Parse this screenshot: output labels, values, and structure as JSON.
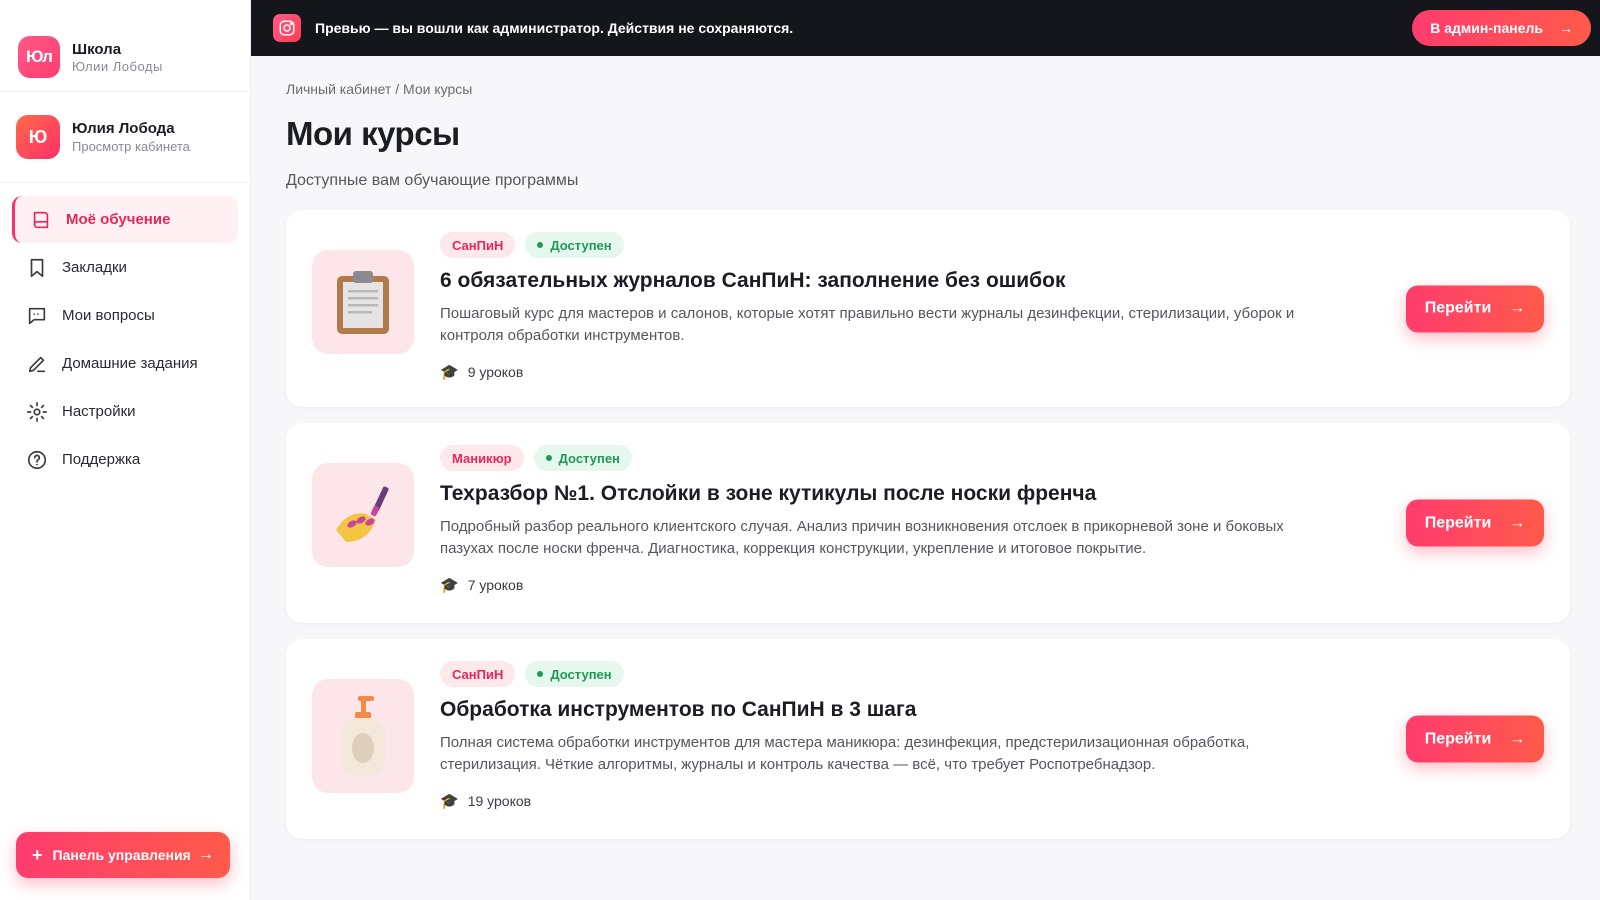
{
  "brand": {
    "logo": "Юл",
    "line1": "Школа",
    "line2": "Юлии Лободы"
  },
  "user": {
    "initial": "Ю",
    "name": "Юлия Лобода",
    "role": "Просмотр кабинета"
  },
  "nav": [
    {
      "label": "Моё обучение",
      "icon": "book-icon",
      "active": true
    },
    {
      "label": "Закладки",
      "icon": "bookmark-icon"
    },
    {
      "label": "Мои вопросы",
      "icon": "chat-icon"
    },
    {
      "label": "Домашние задания",
      "icon": "pencil-icon"
    },
    {
      "label": "Настройки",
      "icon": "gear-icon"
    },
    {
      "label": "Поддержка",
      "icon": "help-icon"
    }
  ],
  "panel_button": {
    "label": "Панель управления"
  },
  "topbar": {
    "message": "Превью — вы вошли как администратор. Действия не сохраняются.",
    "admin_button": "В админ-панель"
  },
  "breadcrumb": {
    "root": "Личный кабинет",
    "separator": " / ",
    "current": "Мои курсы"
  },
  "page": {
    "title": "Мои курсы",
    "subtitle": "Доступные вам обучающие программы"
  },
  "courses": [
    {
      "category": "СанПиН",
      "status": "Доступен",
      "title": "6 обязательных журналов СанПиН: заполнение без ошибок",
      "description": "Пошаговый курс для мастеров и салонов, которые хотят правильно вести журналы дезинфекции, стерилизации, уборок и контроля обработки инструментов.",
      "lessons": "9 уроков",
      "button": "Перейти",
      "thumb_icon": "clipboard-icon"
    },
    {
      "category": "Маникюр",
      "status": "Доступен",
      "title": "Техразбор №1. Отслойки в зоне кутикулы после носки френча",
      "description": "Подробный разбор реального клиентского случая. Анализ причин возникновения отслоек в прикорневой зоне и боковых пазухах после носки френча. Диагностика, коррекция конструкции, укрепление и итоговое покрытие.",
      "lessons": "7 уроков",
      "button": "Перейти",
      "thumb_icon": "nail-polish-icon"
    },
    {
      "category": "СанПиН",
      "status": "Доступен",
      "title": "Обработка инструментов по СанПиН в 3 шага",
      "description": "Полная система обработки инструментов для мастера маникюра: дезинфекция, предстерилизационная обработка, стерилизация. Чёткие алгоритмы, журналы и контроль качества — всё, что требует Роспотребнадзор.",
      "lessons": "19 уроков",
      "button": "Перейти",
      "thumb_icon": "lotion-bottle-icon"
    }
  ],
  "colors": {
    "accent": "#ff3c6e",
    "accent2": "#ff5a4a",
    "topbar": "#15151c",
    "success": "#1e9a55"
  }
}
